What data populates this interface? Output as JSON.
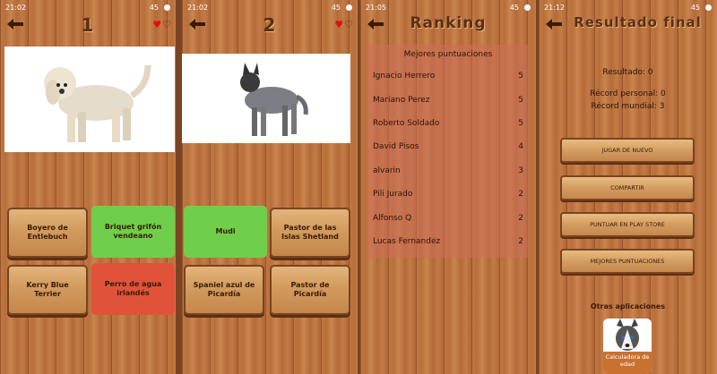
{
  "colors": {
    "correct": "#6fcf4a",
    "wrong": "#e0533a",
    "title": "#5a2f14"
  },
  "screens": [
    {
      "time": "21:02",
      "title": "1",
      "hearts": {
        "full": "♥",
        "empty": "♡"
      },
      "options": [
        "Boyero de Entlebuch",
        "Briquet grifón vendeano",
        "Kerry Blue Terrier",
        "Perro de agua irlandés"
      ]
    },
    {
      "time": "21:02",
      "title": "2",
      "hearts": {
        "full": "♥",
        "empty": "♡"
      },
      "options": [
        "Mudi",
        "Pastor de las Islas Shetland",
        "Spaniel azul de Picardía",
        "Pastor de Picardía"
      ]
    },
    {
      "time": "21:05",
      "title": "Ranking",
      "header": "Mejores puntuaciones",
      "ranking": [
        {
          "name": "Ignacio Herrero",
          "score": "5"
        },
        {
          "name": "Mariano Perez",
          "score": "5"
        },
        {
          "name": "Roberto Soldado",
          "score": "5"
        },
        {
          "name": "David Pisos",
          "score": "4"
        },
        {
          "name": "alvarin",
          "score": "3"
        },
        {
          "name": "Pili Jurado",
          "score": "2"
        },
        {
          "name": "Alfonso Q",
          "score": "2"
        },
        {
          "name": "Lucas Fernandez",
          "score": "2"
        }
      ]
    },
    {
      "time": "21:12",
      "title": "Resultado final",
      "result": "Resultado: 0",
      "personal": "Récord personal: 0",
      "world": "Récord mundial: 3",
      "buttons": [
        "JUGAR DE NUEVO",
        "COMPARTIR",
        "PUNTUAR EN PLAY STORE",
        "MEJORES PUNTUACIONES"
      ],
      "other_apps": "Otras aplicaciones",
      "app_caption": "Calculadora de edad"
    }
  ],
  "status_right": "45"
}
